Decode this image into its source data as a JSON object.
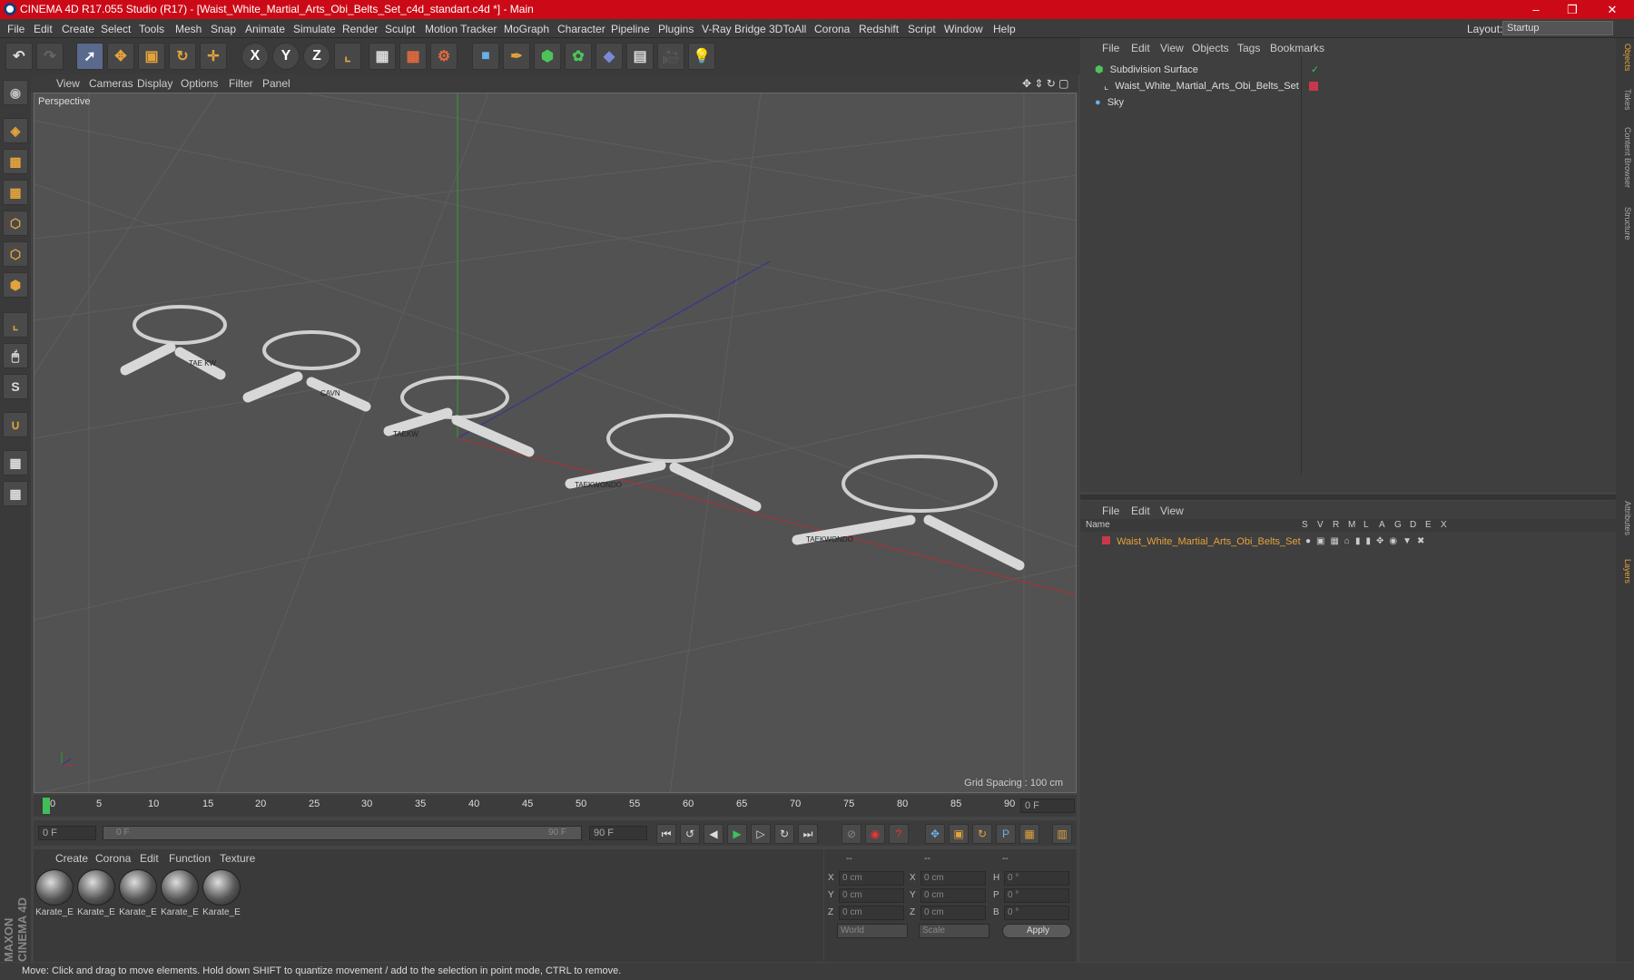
{
  "window": {
    "title": "CINEMA 4D R17.055 Studio (R17) - [Waist_White_Martial_Arts_Obi_Belts_Set_c4d_standart.c4d *] - Main",
    "minimize": "–",
    "maximize": "❐",
    "close": "✕"
  },
  "menu": [
    "File",
    "Edit",
    "Create",
    "Select",
    "Tools",
    "Mesh",
    "Snap",
    "Animate",
    "Simulate",
    "Render",
    "Sculpt",
    "Motion Tracker",
    "MoGraph",
    "Character",
    "Pipeline",
    "Plugins",
    "V-Ray Bridge",
    "3DToAll",
    "Corona",
    "Redshift",
    "Script",
    "Window",
    "Help"
  ],
  "layout": {
    "label": "Layout:",
    "value": "Startup"
  },
  "toolbar": {
    "x_axis": "X",
    "y_axis": "Y",
    "z_axis": "Z"
  },
  "viewport": {
    "menu": [
      "View",
      "Cameras",
      "Display",
      "Options",
      "Filter",
      "Panel"
    ],
    "label": "Perspective",
    "grid_spacing": "Grid Spacing : 100 cm",
    "belt_texts": [
      "TAE KW",
      "CAVN",
      "TAEKW",
      "TAEKWONDO",
      "TAEKWONDO"
    ]
  },
  "timeline": {
    "ticks": [
      "0",
      "5",
      "10",
      "15",
      "20",
      "25",
      "30",
      "35",
      "40",
      "45",
      "50",
      "55",
      "60",
      "65",
      "70",
      "75",
      "80",
      "85",
      "90"
    ],
    "current_frame": "0 F",
    "start": "0 F",
    "range_start": "0 F",
    "range_end": "90 F",
    "end": "90 F"
  },
  "material_panel": {
    "menu": [
      "Create",
      "Corona",
      "Edit",
      "Function",
      "Texture"
    ],
    "materials": [
      "Karate_E",
      "Karate_E",
      "Karate_E",
      "Karate_E",
      "Karate_E"
    ]
  },
  "coords": {
    "headers": [
      "--",
      "--",
      "--"
    ],
    "rows": [
      {
        "a": "X",
        "av": "0 cm",
        "b": "X",
        "bv": "0 cm",
        "c": "H",
        "cv": "0 °"
      },
      {
        "a": "Y",
        "av": "0 cm",
        "b": "Y",
        "bv": "0 cm",
        "c": "P",
        "cv": "0 °"
      },
      {
        "a": "Z",
        "av": "0 cm",
        "b": "Z",
        "bv": "0 cm",
        "c": "B",
        "cv": "0 °"
      }
    ],
    "world": "World",
    "scale": "Scale",
    "apply": "Apply"
  },
  "object_manager": {
    "menu": [
      "File",
      "Edit",
      "View",
      "Objects",
      "Tags",
      "Bookmarks"
    ],
    "objects": [
      "Subdivision Surface",
      "Waist_White_Martial_Arts_Obi_Belts_Set",
      "Sky"
    ]
  },
  "layer_manager": {
    "menu": [
      "File",
      "Edit",
      "View"
    ],
    "columns": {
      "name": "Name",
      "flags": [
        "S",
        "V",
        "R",
        "M",
        "L",
        "A",
        "G",
        "D",
        "E",
        "X"
      ]
    },
    "layer": "Waist_White_Martial_Arts_Obi_Belts_Set"
  },
  "right_tabs": [
    "Objects",
    "Takes",
    "Content Browser",
    "Structure",
    "Attributes",
    "Layers"
  ],
  "status": "Move: Click and drag to move elements. Hold down SHIFT to quantize movement / add to the selection in point mode, CTRL to remove.",
  "brand": "MAXON CINEMA 4D",
  "colors": {
    "title_bar": "#cc0a17",
    "accent": "#e3a33c",
    "x_axis": "#b03030",
    "y_axis": "#2fa02f",
    "z_axis": "#3030a0"
  }
}
